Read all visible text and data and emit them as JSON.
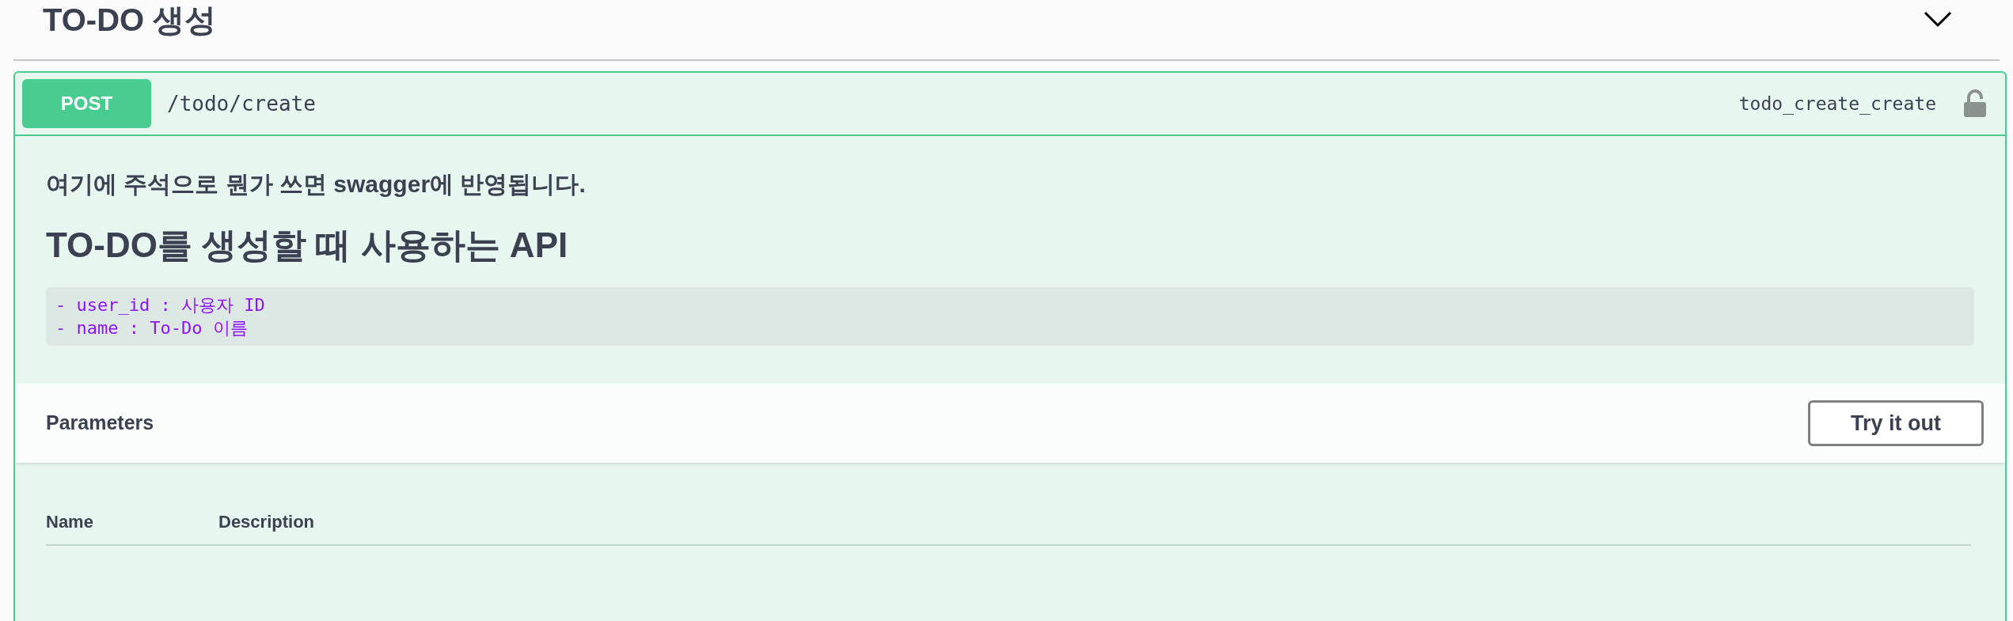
{
  "section": {
    "title": "TO-DO 생성",
    "expanded": true
  },
  "operation": {
    "method": "POST",
    "path": "/todo/create",
    "operation_id": "todo_create_create",
    "locked": false
  },
  "description": {
    "paragraph": "여기에 주석으로 뭔가 쓰면 swagger에 반영됩니다.",
    "heading": "TO-DO를 생성할 때 사용하는 API",
    "code_lines": [
      "- user_id : 사용자 ID",
      "- name : To-Do 이름"
    ]
  },
  "parameters": {
    "title": "Parameters",
    "button": "Try it out",
    "columns": [
      "Name",
      "Description"
    ]
  }
}
